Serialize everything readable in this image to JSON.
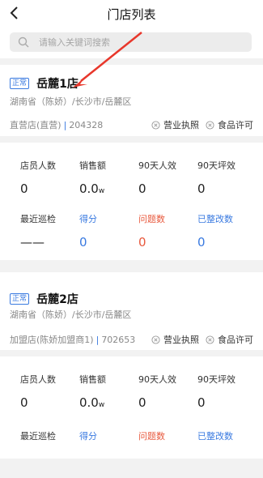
{
  "header": {
    "title": "门店列表"
  },
  "search": {
    "placeholder": "请输入关键词搜索"
  },
  "stores": [
    {
      "status": "正常",
      "name": "岳麓1店",
      "region": "湖南省（陈娇）/长沙市/岳麓区",
      "type": "直营店(直营)",
      "code": "204328",
      "licenses": [
        "营业执照",
        "食品许可"
      ],
      "stats_row1": [
        {
          "label": "店员人数",
          "value": "0"
        },
        {
          "label": "销售额",
          "value": "0.0",
          "unit": "w"
        },
        {
          "label": "90天人效",
          "value": "0"
        },
        {
          "label": "90天坪效",
          "value": "0"
        }
      ],
      "stats_row2": [
        {
          "label": "最近巡检",
          "value": "——"
        },
        {
          "label": "得分",
          "value": "0"
        },
        {
          "label": "问题数",
          "value": "0"
        },
        {
          "label": "已整改数",
          "value": "0"
        }
      ]
    },
    {
      "status": "正常",
      "name": "岳麓2店",
      "region": "湖南省（陈娇）/长沙市/岳麓区",
      "type": "加盟店(陈娇加盟商1)",
      "code": "702653",
      "licenses": [
        "营业执照",
        "食品许可"
      ],
      "stats_row1": [
        {
          "label": "店员人数",
          "value": "0"
        },
        {
          "label": "销售额",
          "value": "0.0",
          "unit": "w"
        },
        {
          "label": "90天人效",
          "value": "0"
        },
        {
          "label": "90天坪效",
          "value": "0"
        }
      ],
      "stats_row2": [
        {
          "label": "最近巡检"
        },
        {
          "label": "得分"
        },
        {
          "label": "问题数"
        },
        {
          "label": "已整改数"
        }
      ]
    }
  ],
  "colors": {
    "accent": "#3a7ae0",
    "warning": "#e8593d",
    "annotation": "#e8372b"
  }
}
